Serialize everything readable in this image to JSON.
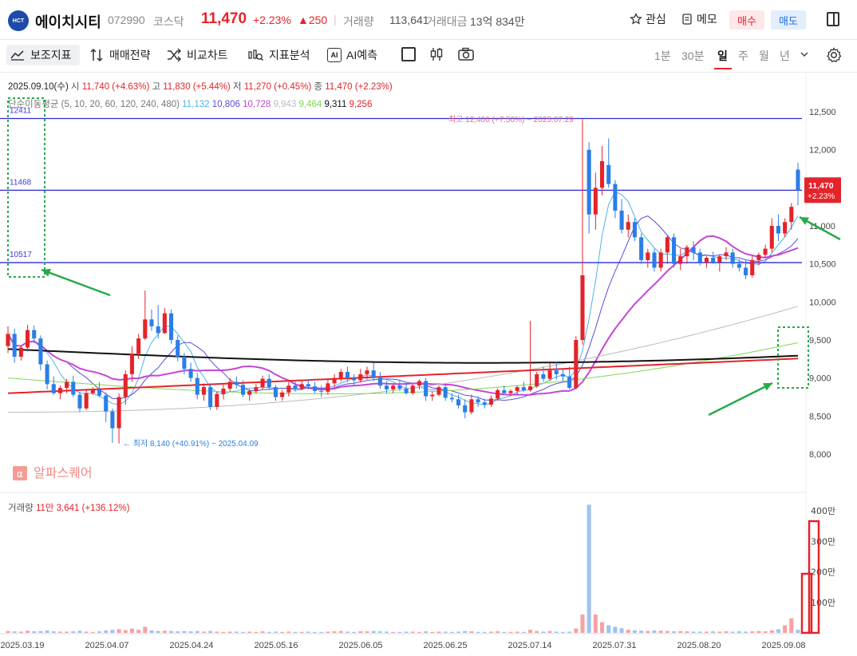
{
  "header": {
    "logo_text": "HCT",
    "name": "에이치시티",
    "code": "072990",
    "market": "코스닥",
    "price": "11,470",
    "change_pct": "+2.23%",
    "change_abs": "▲250",
    "volume_label": "거래량",
    "volume_value": "113,641",
    "amount_label": "거래대금",
    "amount_value": "13억 834만",
    "watch_label": "관심",
    "memo_label": "메모",
    "buy_label": "매수",
    "sell_label": "매도"
  },
  "toolbar": {
    "indicator_label": "보조지표",
    "strategy_label": "매매전략",
    "compare_label": "비교차트",
    "analysis_label": "지표분석",
    "ai_label": "AI예측",
    "ai_icon_text": "AI",
    "periods": [
      "1분",
      "30분",
      "일",
      "주",
      "월",
      "년"
    ],
    "selected_period": "일"
  },
  "legend": {
    "ohlc_date": "2025.09.10(수)",
    "open_label": "시",
    "open_value": "11,740 (+4.63%)",
    "high_label": "고",
    "high_value": "11,830 (+5.44%)",
    "low_label": "저",
    "low_value": "11,270 (+0.45%)",
    "close_label": "종",
    "close_value": "11,470 (+2.23%)",
    "ma_label": "단순이동평균 (5, 10, 20, 60, 120, 240, 480)",
    "ma_values": [
      {
        "value": "11,132",
        "color": "#4fb3e8"
      },
      {
        "value": "10,806",
        "color": "#5a4fd6"
      },
      {
        "value": "10,728",
        "color": "#c447d6"
      },
      {
        "value": "9,943",
        "color": "#bbbbbb"
      },
      {
        "value": "9,464",
        "color": "#7ed957"
      },
      {
        "value": "9,311",
        "color": "#111111"
      },
      {
        "value": "9,256",
        "color": "#e5232a"
      }
    ]
  },
  "annotations": {
    "high_text": "최고 12,400 (+7.50%) ~ 2025.07.29",
    "low_text": "최저 8,140 (+40.91%) ~ 2025.04.09",
    "hline_labels": [
      "12411",
      "11468",
      "10517"
    ],
    "price_tag": "11,470",
    "price_tag_pct": "+2.23%",
    "watermark": "알파스퀘어",
    "volume_label": "거래량",
    "volume_value": "11만 3,641 (+136.12%)"
  },
  "chart_data": {
    "type": "candlestick",
    "y_ticks": [
      "12,500",
      "12,000",
      "11,500",
      "11,000",
      "10,500",
      "10,000",
      "9,500",
      "9,000",
      "8,500",
      "8,000"
    ],
    "ylim": [
      7700,
      12900
    ],
    "x_ticks": [
      "2025.03.19",
      "2025.04.07",
      "2025.04.24",
      "2025.05.16",
      "2025.06.05",
      "2025.06.25",
      "2025.07.14",
      "2025.07.31",
      "2025.08.20",
      "2025.09.08"
    ],
    "horizontal_lines": [
      12411,
      11468,
      10517
    ],
    "candles": [
      [
        9420,
        9680,
        9330,
        9580
      ],
      [
        9580,
        9650,
        9200,
        9280
      ],
      [
        9280,
        9430,
        9230,
        9400
      ],
      [
        9400,
        9700,
        9350,
        9630
      ],
      [
        9630,
        9690,
        9460,
        9520
      ],
      [
        9520,
        9560,
        9100,
        9180
      ],
      [
        9180,
        9230,
        8850,
        8920
      ],
      [
        8920,
        9020,
        8780,
        8800
      ],
      [
        8800,
        8900,
        8720,
        8870
      ],
      [
        8870,
        8990,
        8800,
        8950
      ],
      [
        8950,
        9030,
        8750,
        8780
      ],
      [
        8780,
        8820,
        8550,
        8600
      ],
      [
        8600,
        8850,
        8580,
        8800
      ],
      [
        8800,
        8880,
        8780,
        8850
      ],
      [
        8850,
        8950,
        8750,
        8770
      ],
      [
        8770,
        8810,
        8420,
        8560
      ],
      [
        8560,
        8600,
        8150,
        8340
      ],
      [
        8340,
        8800,
        8140,
        8750
      ],
      [
        8750,
        9100,
        8650,
        9050
      ],
      [
        9050,
        9420,
        8950,
        9320
      ],
      [
        9320,
        9580,
        9250,
        9520
      ],
      [
        9520,
        10150,
        9500,
        9770
      ],
      [
        9770,
        9900,
        9620,
        9680
      ],
      [
        9680,
        9960,
        9520,
        9590
      ],
      [
        9590,
        9920,
        9580,
        9850
      ],
      [
        9850,
        9900,
        9450,
        9500
      ],
      [
        9500,
        9560,
        9220,
        9280
      ],
      [
        9280,
        9330,
        9050,
        9120
      ],
      [
        9120,
        9200,
        8950,
        9000
      ],
      [
        9000,
        9070,
        8720,
        8780
      ],
      [
        8780,
        8930,
        8700,
        8880
      ],
      [
        8880,
        8930,
        8580,
        8620
      ],
      [
        8620,
        8820,
        8580,
        8790
      ],
      [
        8790,
        8910,
        8720,
        8860
      ],
      [
        8860,
        9000,
        8820,
        8950
      ],
      [
        8950,
        9020,
        8860,
        8910
      ],
      [
        8910,
        8970,
        8750,
        8780
      ],
      [
        8780,
        8850,
        8700,
        8830
      ],
      [
        8830,
        8920,
        8790,
        8880
      ],
      [
        8880,
        9030,
        8850,
        8990
      ],
      [
        8990,
        9050,
        8850,
        8880
      ],
      [
        8880,
        8910,
        8700,
        8750
      ],
      [
        8750,
        8840,
        8700,
        8810
      ],
      [
        8810,
        8950,
        8760,
        8900
      ],
      [
        8900,
        8970,
        8820,
        8860
      ],
      [
        8860,
        8960,
        8840,
        8920
      ],
      [
        8920,
        8980,
        8850,
        8890
      ],
      [
        8890,
        8950,
        8800,
        8830
      ],
      [
        8830,
        8900,
        8750,
        8820
      ],
      [
        8820,
        8980,
        8780,
        8930
      ],
      [
        8930,
        9050,
        8880,
        9000
      ],
      [
        9000,
        9120,
        8950,
        9080
      ],
      [
        9080,
        9150,
        8950,
        9000
      ],
      [
        9000,
        9050,
        8900,
        8970
      ],
      [
        8970,
        9120,
        8940,
        9050
      ],
      [
        9050,
        9150,
        8980,
        9100
      ],
      [
        9100,
        9200,
        8960,
        9000
      ],
      [
        9000,
        9080,
        8860,
        8900
      ],
      [
        8900,
        8960,
        8800,
        8850
      ],
      [
        8850,
        8930,
        8800,
        8900
      ],
      [
        8900,
        8970,
        8830,
        8860
      ],
      [
        8860,
        8920,
        8780,
        8800
      ],
      [
        8800,
        8930,
        8780,
        8900
      ],
      [
        8900,
        8980,
        8850,
        8960
      ],
      [
        8960,
        9000,
        8700,
        8760
      ],
      [
        8760,
        8820,
        8700,
        8780
      ],
      [
        8780,
        8900,
        8760,
        8880
      ],
      [
        8880,
        8920,
        8700,
        8740
      ],
      [
        8740,
        8800,
        8680,
        8720
      ],
      [
        8720,
        8780,
        8600,
        8640
      ],
      [
        8640,
        8720,
        8470,
        8550
      ],
      [
        8550,
        8780,
        8520,
        8720
      ],
      [
        8720,
        8760,
        8620,
        8680
      ],
      [
        8680,
        8730,
        8600,
        8650
      ],
      [
        8650,
        8770,
        8620,
        8730
      ],
      [
        8730,
        8860,
        8700,
        8840
      ],
      [
        8840,
        8900,
        8780,
        8800
      ],
      [
        8800,
        8850,
        8760,
        8830
      ],
      [
        8830,
        8900,
        8780,
        8880
      ],
      [
        8880,
        8950,
        8820,
        8840
      ],
      [
        8840,
        9750,
        8820,
        8890
      ],
      [
        8890,
        9080,
        8870,
        9050
      ],
      [
        9050,
        9150,
        8950,
        8990
      ],
      [
        8990,
        9200,
        8960,
        9100
      ],
      [
        9100,
        9220,
        8980,
        9050
      ],
      [
        9050,
        9120,
        8960,
        9020
      ],
      [
        9020,
        9150,
        8850,
        8870
      ],
      [
        8870,
        9550,
        8850,
        9500
      ],
      [
        9500,
        12400,
        9440,
        10350
      ],
      [
        12000,
        12100,
        10900,
        11150
      ],
      [
        11150,
        11700,
        10950,
        11500
      ],
      [
        11500,
        12050,
        11400,
        11850
      ],
      [
        11800,
        12150,
        11500,
        11550
      ],
      [
        11550,
        11600,
        11100,
        11200
      ],
      [
        11200,
        11350,
        10900,
        10950
      ],
      [
        10950,
        11150,
        10850,
        11050
      ],
      [
        11050,
        11100,
        10800,
        10850
      ],
      [
        10850,
        10900,
        10500,
        10550
      ],
      [
        10550,
        10700,
        10450,
        10650
      ],
      [
        10650,
        10700,
        10400,
        10450
      ],
      [
        10450,
        10700,
        10400,
        10650
      ],
      [
        10650,
        10880,
        10500,
        10850
      ],
      [
        10850,
        10900,
        10450,
        10500
      ],
      [
        10500,
        10700,
        10420,
        10600
      ],
      [
        10600,
        10750,
        10500,
        10720
      ],
      [
        10720,
        10800,
        10550,
        10650
      ],
      [
        10650,
        10700,
        10480,
        10520
      ],
      [
        10520,
        10600,
        10450,
        10580
      ],
      [
        10580,
        10660,
        10500,
        10520
      ],
      [
        10520,
        10620,
        10400,
        10600
      ],
      [
        10600,
        10720,
        10550,
        10650
      ],
      [
        10650,
        10700,
        10450,
        10500
      ],
      [
        10500,
        10560,
        10400,
        10450
      ],
      [
        10450,
        10550,
        10300,
        10350
      ],
      [
        10350,
        10600,
        10320,
        10550
      ],
      [
        10550,
        10650,
        10480,
        10620
      ],
      [
        10620,
        10750,
        10580,
        10700
      ],
      [
        10700,
        11100,
        10650,
        11000
      ],
      [
        11000,
        11150,
        10800,
        10900
      ],
      [
        10900,
        11100,
        10850,
        11050
      ],
      [
        11050,
        11300,
        10950,
        11250
      ],
      [
        11740,
        11830,
        11270,
        11470
      ]
    ],
    "volume": [
      6,
      5,
      4,
      7,
      5,
      6,
      8,
      5,
      4,
      4,
      5,
      7,
      4,
      3,
      5,
      8,
      10,
      12,
      9,
      14,
      10,
      20,
      8,
      6,
      7,
      6,
      5,
      6,
      5,
      6,
      4,
      6,
      4,
      3,
      4,
      4,
      3,
      4,
      3,
      5,
      3,
      4,
      3,
      4,
      3,
      3,
      4,
      3,
      3,
      4,
      5,
      6,
      4,
      3,
      5,
      5,
      6,
      5,
      4,
      3,
      3,
      4,
      4,
      3,
      5,
      3,
      4,
      4,
      3,
      4,
      6,
      5,
      3,
      3,
      4,
      5,
      3,
      3,
      4,
      3,
      10,
      6,
      4,
      6,
      4,
      3,
      4,
      14,
      60,
      420,
      60,
      35,
      25,
      20,
      15,
      10,
      8,
      7,
      6,
      8,
      7,
      6,
      5,
      6,
      5,
      4,
      4,
      4,
      5,
      4,
      5,
      4,
      5,
      4,
      5,
      6,
      5,
      8,
      12,
      25,
      48,
      10
    ],
    "volume_ticks": [
      "400만",
      "300만",
      "200만",
      "100만"
    ]
  }
}
